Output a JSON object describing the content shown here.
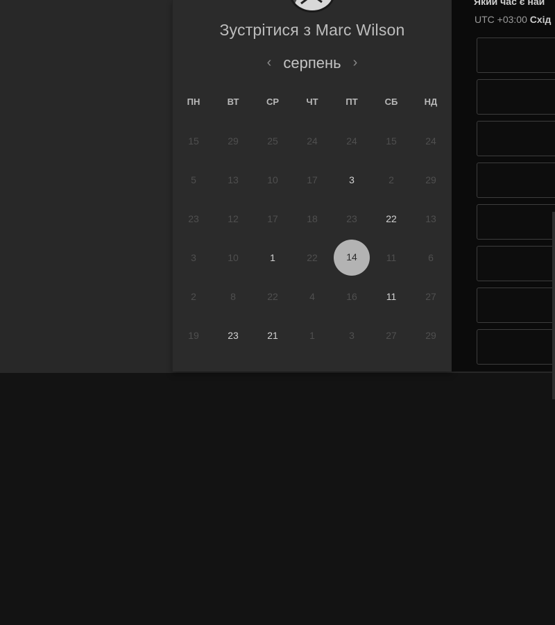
{
  "booking": {
    "title": "Зустрітися з Marc Wilson",
    "month": "серпень",
    "prev_icon": "‹",
    "next_icon": "›",
    "weekdays": [
      "ПН",
      "ВТ",
      "СР",
      "ЧТ",
      "ПТ",
      "СБ",
      "НД"
    ],
    "days": [
      [
        "15",
        "29",
        "25",
        "24",
        "24",
        "15",
        "24"
      ],
      [
        "5",
        "13",
        "10",
        "17",
        "3",
        "2",
        "29"
      ],
      [
        "23",
        "12",
        "17",
        "18",
        "23",
        "22",
        "13"
      ],
      [
        "3",
        "10",
        "1",
        "22",
        "14",
        "11",
        "6"
      ],
      [
        "2",
        "8",
        "22",
        "4",
        "16",
        "11",
        "27"
      ],
      [
        "19",
        "23",
        "21",
        "1",
        "3",
        "27",
        "29"
      ]
    ],
    "available_days": [
      {
        "row": 1,
        "col": 4
      },
      {
        "row": 2,
        "col": 5
      },
      {
        "row": 3,
        "col": 2
      },
      {
        "row": 4,
        "col": 5
      },
      {
        "row": 5,
        "col": 1
      },
      {
        "row": 5,
        "col": 2
      }
    ],
    "selected_day": {
      "row": 3,
      "col": 4,
      "label": "14"
    }
  },
  "times": {
    "question": "Який час є най",
    "timezone_prefix": "UTC +03:00",
    "timezone_name": "Схід",
    "slot_count": 8
  }
}
